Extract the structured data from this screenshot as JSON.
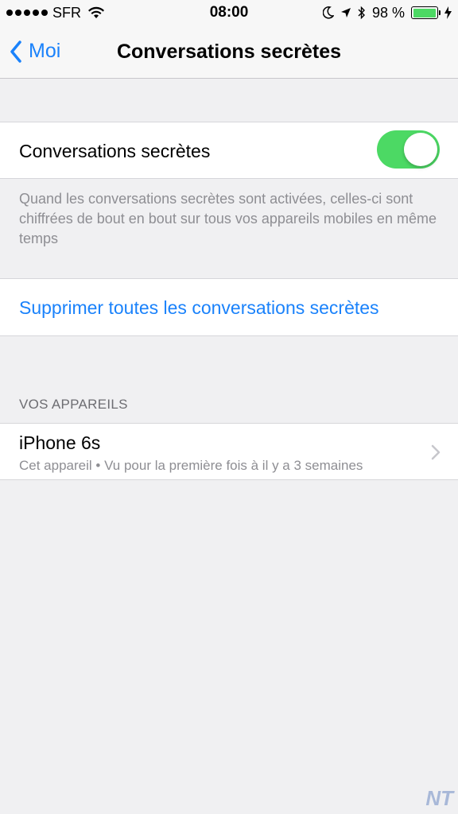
{
  "status_bar": {
    "carrier": "SFR",
    "time": "08:00",
    "battery_percent": "98 %",
    "battery_level": 0.98
  },
  "nav": {
    "back_label": "Moi",
    "title": "Conversations secrètes"
  },
  "settings": {
    "toggle_label": "Conversations secrètes",
    "toggle_on": true,
    "description": "Quand les conversations secrètes sont activées, celles-ci sont chiffrées de bout en bout sur tous vos appareils mobiles en même temps",
    "delete_label": "Supprimer toutes les conversations secrètes"
  },
  "devices": {
    "header": "VOS APPAREILS",
    "items": [
      {
        "name": "iPhone 6s",
        "detail": "Cet appareil • Vu pour la première fois à il y a 3 semaines"
      }
    ]
  },
  "watermark": "NT",
  "colors": {
    "accent": "#1a82fb",
    "switch_on": "#4cd964",
    "secondary_text": "#8e8e93"
  }
}
